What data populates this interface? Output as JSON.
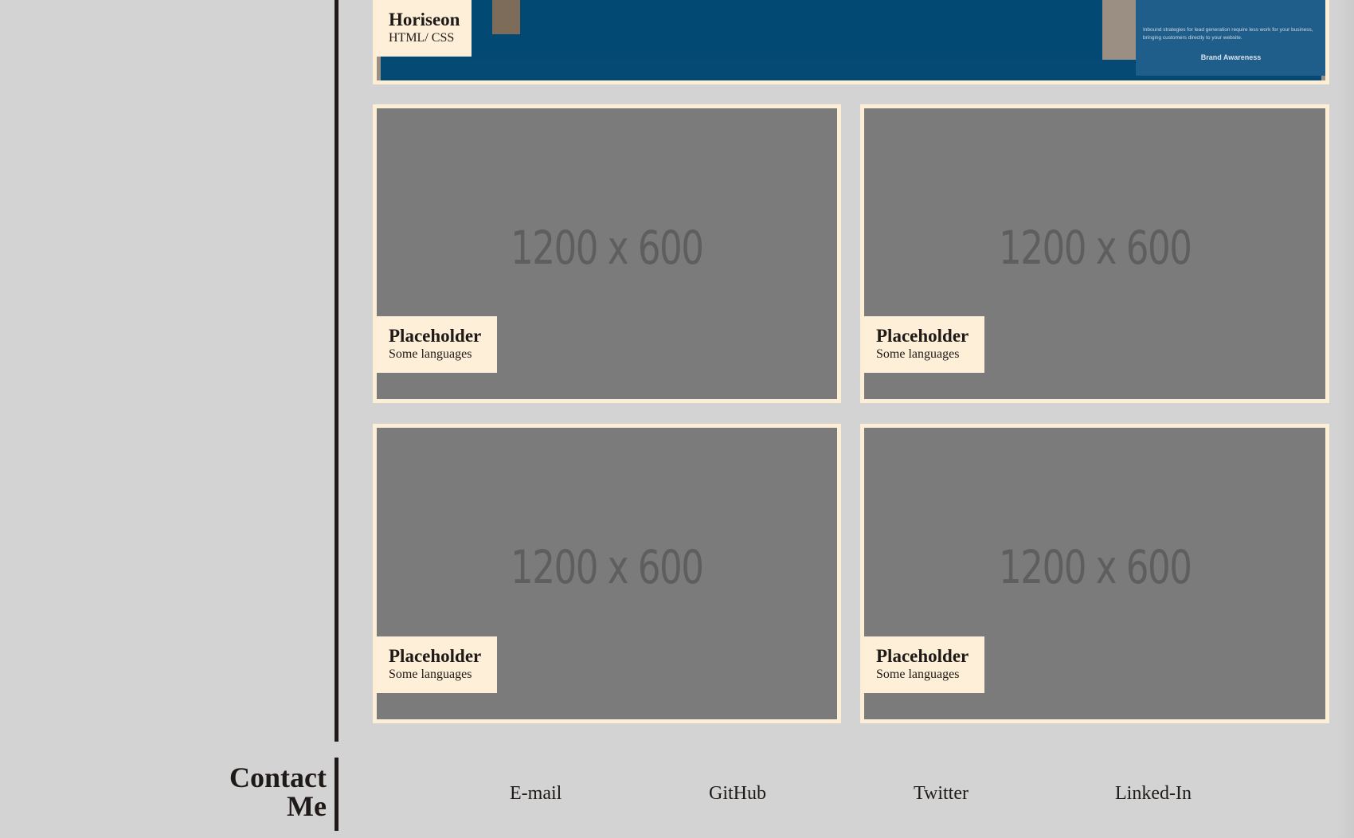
{
  "hero_project": {
    "title": "Horiseon",
    "subtitle": "HTML/ CSS",
    "side_text": "Inbound strategies for lead generation require less work for your business, bringing customers directly to your website.",
    "side_link": "Brand Awareness"
  },
  "projects": [
    {
      "title": "Placeholder",
      "subtitle": "Some languages",
      "image_text": "1200 x 600"
    },
    {
      "title": "Placeholder",
      "subtitle": "Some languages",
      "image_text": "1200 x 600"
    },
    {
      "title": "Placeholder",
      "subtitle": "Some languages",
      "image_text": "1200 x 600"
    },
    {
      "title": "Placeholder",
      "subtitle": "Some languages",
      "image_text": "1200 x 600"
    }
  ],
  "contact": {
    "title_line1": "Contact",
    "title_line2": "Me",
    "links": [
      "E-mail",
      "GitHub",
      "Twitter",
      "Linked-In"
    ]
  }
}
